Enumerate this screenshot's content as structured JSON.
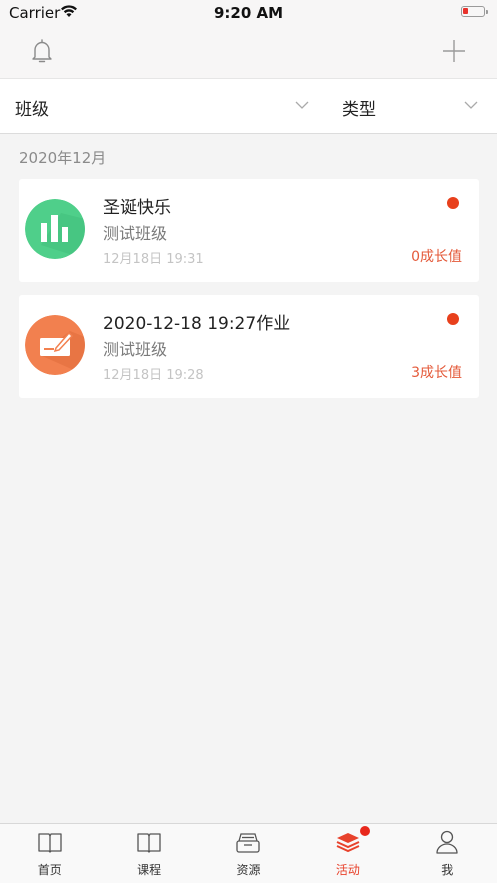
{
  "status_bar": {
    "carrier": "Carrier",
    "time": "9:20 AM"
  },
  "nav": {
    "left_icon": "bell-icon",
    "right_icon": "plus-icon"
  },
  "filters": [
    {
      "label": "班级",
      "icon": "chevron-down-icon"
    },
    {
      "label": "类型",
      "icon": "chevron-down-icon"
    }
  ],
  "section": {
    "label": "2020年12月"
  },
  "activities": [
    {
      "title": "圣诞快乐",
      "class_name": "测试班级",
      "date": "12月18日 19:31",
      "growth": "0成长值",
      "icon": "bar-chart-icon",
      "icon_color": "#4fcf8a",
      "unread": true
    },
    {
      "title": "2020-12-18 19:27作业",
      "class_name": "测试班级",
      "date": "12月18日 19:28",
      "growth": "3成长值",
      "icon": "homework-icon",
      "icon_color": "#f2804f",
      "unread": true
    }
  ],
  "tabs": [
    {
      "label": "首页",
      "icon": "book-icon",
      "active": false
    },
    {
      "label": "课程",
      "icon": "course-book-icon",
      "active": false
    },
    {
      "label": "资源",
      "icon": "archive-icon",
      "active": false
    },
    {
      "label": "活动",
      "icon": "stack-icon",
      "active": true,
      "badge": true
    },
    {
      "label": "我",
      "icon": "person-icon",
      "active": false
    }
  ],
  "colors": {
    "accent": "#e8422c",
    "unread_dot": "#e8401c"
  }
}
